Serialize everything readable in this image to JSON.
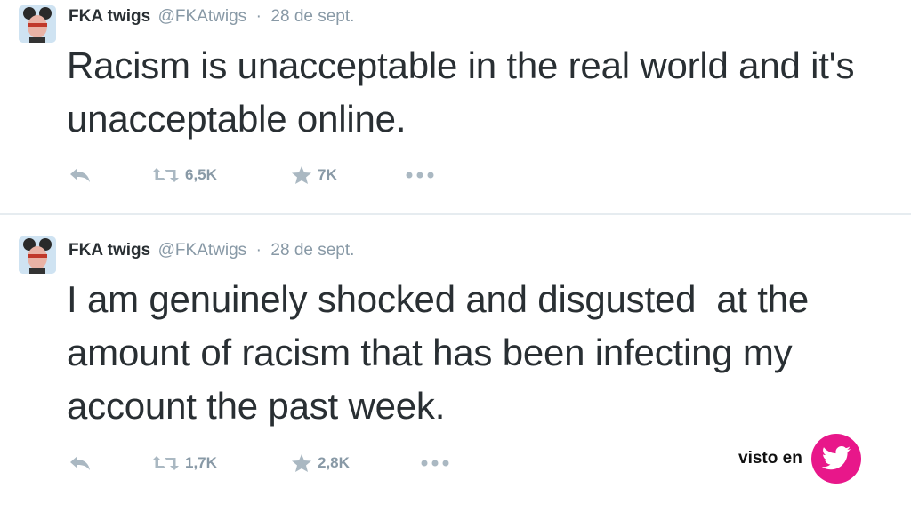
{
  "tweets": [
    {
      "name": "FKA twigs",
      "handle": "@FKAtwigs",
      "separator": "·",
      "date": "28 de sept.",
      "text": "Racism is unacceptable in the real world and it's unacceptable online.",
      "retweets": "6,5K",
      "favorites": "7K"
    },
    {
      "name": "FKA twigs",
      "handle": "@FKAtwigs",
      "separator": "·",
      "date": "28 de sept.",
      "text": "I am genuinely shocked and disgusted  at the amount of racism that has been infecting my account the past week.",
      "retweets": "1,7K",
      "favorites": "2,8K"
    }
  ],
  "badge": {
    "label": "visto en",
    "icon": "twitter-bird-icon",
    "color": "#e8178a"
  },
  "colors": {
    "text": "#292f33",
    "muted": "#8899a6",
    "icon": "#aab8c2",
    "divider": "#e6ecf0"
  },
  "icons": {
    "reply": "reply-icon",
    "retweet": "retweet-icon",
    "favorite": "star-icon",
    "more": "more-dots-icon"
  }
}
